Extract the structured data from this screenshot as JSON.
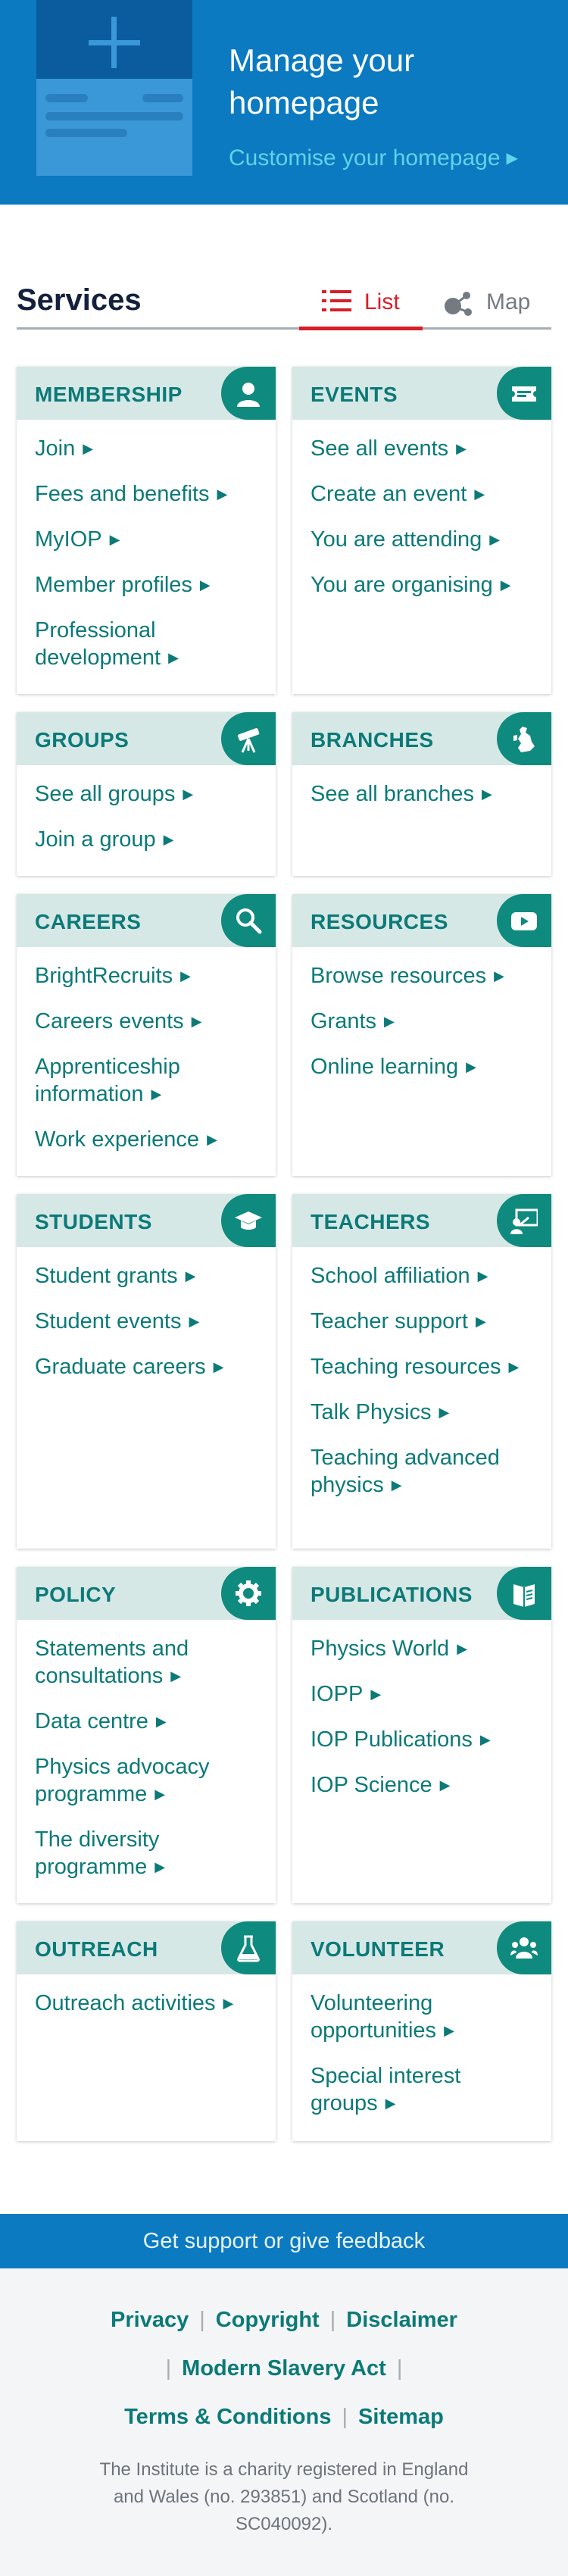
{
  "banner": {
    "title": "Manage your homepage",
    "link": "Customise your homepage",
    "link_arrow": "▶"
  },
  "services": {
    "title": "Services",
    "tabs": [
      {
        "label": "List",
        "active": true,
        "icon": "list-icon"
      },
      {
        "label": "Map",
        "active": false,
        "icon": "map-nodes-icon"
      }
    ]
  },
  "cards": [
    {
      "title": "MEMBERSHIP",
      "icon": "user-icon",
      "links": [
        "Join",
        "Fees and benefits",
        "MyIOP",
        "Member profiles",
        "Professional development"
      ]
    },
    {
      "title": "EVENTS",
      "icon": "ticket-icon",
      "links": [
        "See all events",
        "Create an event",
        "You are attending",
        "You are organising"
      ]
    },
    {
      "title": "GROUPS",
      "icon": "telescope-icon",
      "links": [
        "See all groups",
        "Join a group"
      ]
    },
    {
      "title": "BRANCHES",
      "icon": "uk-map-icon",
      "links": [
        "See all branches"
      ]
    },
    {
      "title": "CAREERS",
      "icon": "search-icon",
      "links": [
        "BrightRecruits",
        "Careers events",
        "Apprenticeship information",
        "Work experience"
      ]
    },
    {
      "title": "RESOURCES",
      "icon": "play-video-icon",
      "links": [
        "Browse resources",
        "Grants",
        "Online learning"
      ]
    },
    {
      "title": "STUDENTS",
      "icon": "graduation-cap-icon",
      "links": [
        "Student grants",
        "Student events",
        "Graduate careers"
      ]
    },
    {
      "title": "TEACHERS",
      "icon": "teacher-board-icon",
      "links": [
        "School affiliation",
        "Teacher support",
        "Teaching resources",
        "Talk Physics",
        "Teaching advanced physics"
      ]
    },
    {
      "title": "POLICY",
      "icon": "gear-icon",
      "links": [
        "Statements and consultations",
        "Data centre",
        "Physics advocacy programme",
        "The diversity programme"
      ]
    },
    {
      "title": "PUBLICATIONS",
      "icon": "open-book-icon",
      "links": [
        "Physics World",
        "IOPP",
        "IOP Publications",
        "IOP Science"
      ]
    },
    {
      "title": "OUTREACH",
      "icon": "flask-icon",
      "links": [
        "Outreach activities"
      ]
    },
    {
      "title": "VOLUNTEER",
      "icon": "group-icon",
      "links": [
        "Volunteering opportunities",
        "Special interest groups"
      ]
    }
  ],
  "link_arrow": "▶",
  "footer": {
    "support": "Get support or give feedback",
    "links": [
      "Privacy",
      "Copyright",
      "Disclaimer",
      "Modern Slavery Act",
      "Terms & Conditions",
      "Sitemap"
    ],
    "separator": "|",
    "charity": "The Institute is a charity registered in England and Wales (no. 293851) and Scotland (no. SC040092)."
  },
  "colors": {
    "brand_blue": "#0b7ac0",
    "teal": "#0b7a78",
    "icon_teal": "#0f8a7e",
    "card_header": "#d6e8e6",
    "active_tab": "#d61f26",
    "navy": "#14213d"
  }
}
